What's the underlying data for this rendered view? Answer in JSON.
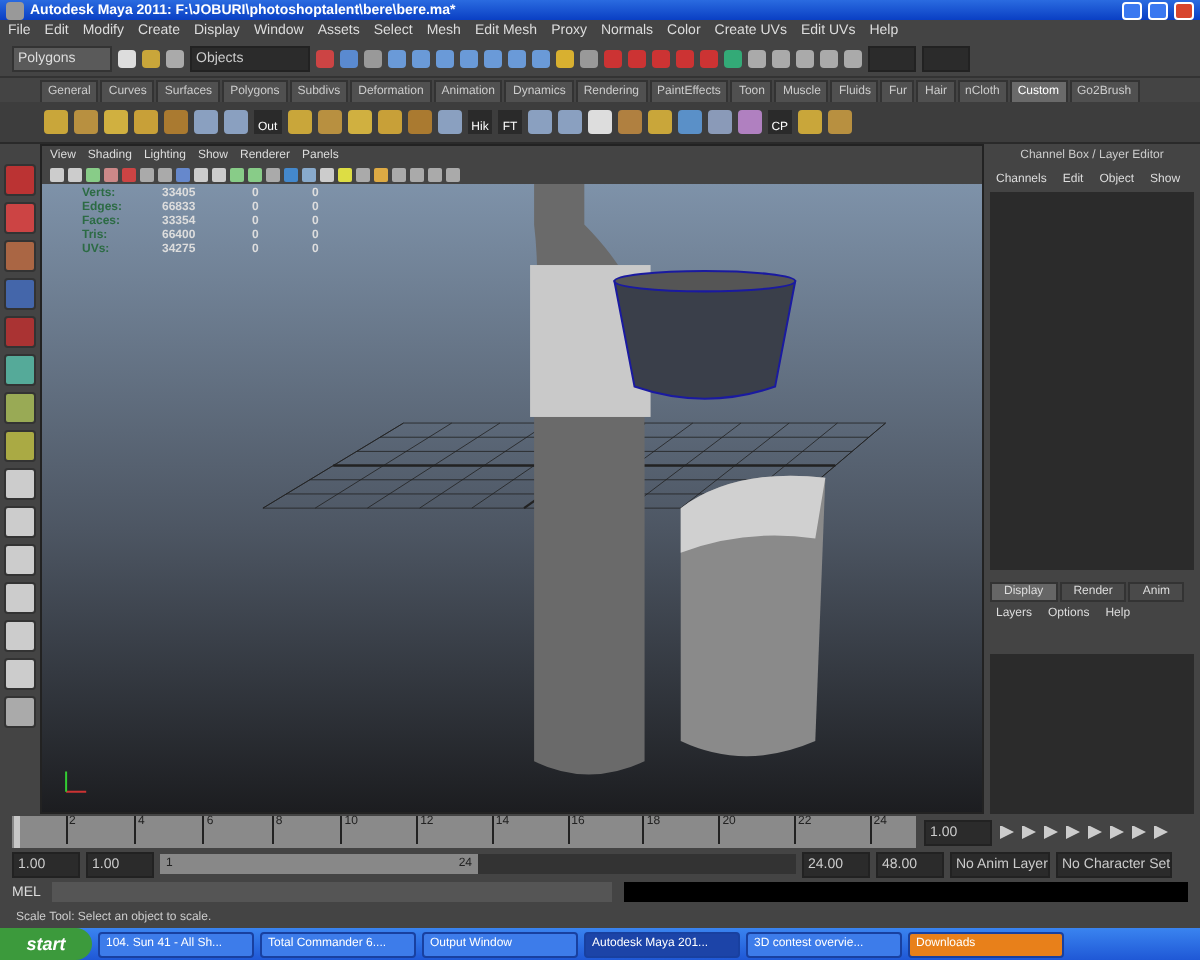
{
  "window": {
    "title": "Autodesk Maya 2011: F:\\JOBURI\\photoshoptalent\\bere\\bere.ma*"
  },
  "menu": [
    "File",
    "Edit",
    "Modify",
    "Create",
    "Display",
    "Window",
    "Assets",
    "Select",
    "Mesh",
    "Edit Mesh",
    "Proxy",
    "Normals",
    "Color",
    "Create UVs",
    "Edit UVs",
    "Help"
  ],
  "toolbar": {
    "mode": "Polygons",
    "objects_field": "Objects"
  },
  "shelf_tabs": [
    {
      "label": "General",
      "selected": false
    },
    {
      "label": "Curves",
      "selected": false
    },
    {
      "label": "Surfaces",
      "selected": false
    },
    {
      "label": "Polygons",
      "selected": false
    },
    {
      "label": "Subdivs",
      "selected": false
    },
    {
      "label": "Deformation",
      "selected": false
    },
    {
      "label": "Animation",
      "selected": false
    },
    {
      "label": "Dynamics",
      "selected": false
    },
    {
      "label": "Rendering",
      "selected": false
    },
    {
      "label": "PaintEffects",
      "selected": false
    },
    {
      "label": "Toon",
      "selected": false
    },
    {
      "label": "Muscle",
      "selected": false
    },
    {
      "label": "Fluids",
      "selected": false
    },
    {
      "label": "Fur",
      "selected": false
    },
    {
      "label": "Hair",
      "selected": false
    },
    {
      "label": "nCloth",
      "selected": false
    },
    {
      "label": "Custom",
      "selected": true
    },
    {
      "label": "Go2Brush",
      "selected": false
    }
  ],
  "shelf_labels": [
    "Out",
    "Hik",
    "FT",
    "CP"
  ],
  "viewport": {
    "menu": [
      "View",
      "Shading",
      "Lighting",
      "Show",
      "Renderer",
      "Panels"
    ],
    "stats": [
      [
        "Verts:",
        "33405",
        "0",
        "0"
      ],
      [
        "Edges:",
        "66833",
        "0",
        "0"
      ],
      [
        "Faces:",
        "33354",
        "0",
        "0"
      ],
      [
        "Tris:",
        "66400",
        "0",
        "0"
      ],
      [
        "UVs:",
        "34275",
        "0",
        "0"
      ]
    ]
  },
  "channel_box": {
    "title": "Channel Box / Layer Editor",
    "menu": [
      "Channels",
      "Edit",
      "Object",
      "Show"
    ]
  },
  "layer_editor": {
    "tabs": [
      {
        "label": "Display",
        "selected": true
      },
      {
        "label": "Render",
        "selected": false
      },
      {
        "label": "Anim",
        "selected": false
      }
    ],
    "menu": [
      "Layers",
      "Options",
      "Help"
    ]
  },
  "timeline": {
    "ticks": [
      "2",
      "4",
      "6",
      "8",
      "10",
      "12",
      "14",
      "16",
      "18",
      "20",
      "22",
      "24"
    ],
    "current": "1.00",
    "level": 0
  },
  "range": {
    "start": "1.00",
    "playback_start": "1.00",
    "slider_start": "1",
    "slider_end": "24",
    "level": 0.5,
    "playback_end": "24.00",
    "end": "48.00",
    "anim_layer": "No Anim Layer",
    "character_set": "No Character Set"
  },
  "command_line": {
    "label": "MEL"
  },
  "help_line": "Scale Tool: Select an object to scale.",
  "taskbar": {
    "start": "start",
    "items": [
      {
        "label": "104. Sun 41 - All Sh...",
        "selected": false
      },
      {
        "label": "Total Commander 6....",
        "selected": false
      },
      {
        "label": "Output Window",
        "selected": false
      },
      {
        "label": "Autodesk Maya 201...",
        "selected": true
      },
      {
        "label": "3D contest overvie...",
        "selected": false
      },
      {
        "label": "Downloads",
        "selected": false,
        "color": "#e8801a"
      }
    ]
  }
}
